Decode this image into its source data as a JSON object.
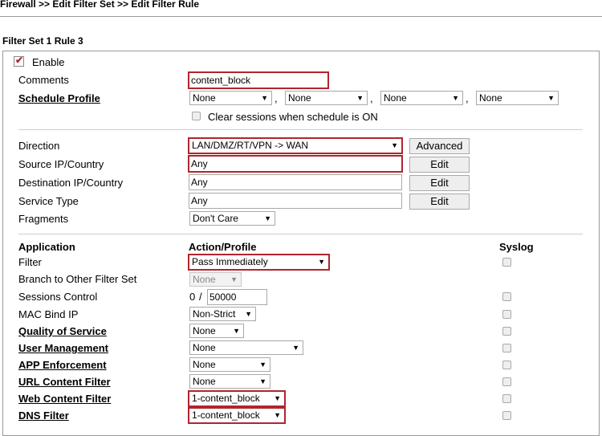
{
  "breadcrumb": "Firewall >> Edit Filter Set >> Edit Filter Rule",
  "set_title": "Filter Set 1 Rule 3",
  "enable": {
    "label": "Enable",
    "checked": true
  },
  "comments": {
    "label": "Comments",
    "value": "content_block"
  },
  "schedule": {
    "label": "Schedule Profile",
    "values": [
      "None",
      "None",
      "None",
      "None"
    ],
    "separator": ",",
    "clear_label": "Clear sessions when schedule is ON"
  },
  "direction": {
    "label": "Direction",
    "value": "LAN/DMZ/RT/VPN -> WAN",
    "button": "Advanced"
  },
  "source": {
    "label": "Source IP/Country",
    "value": "Any",
    "button": "Edit"
  },
  "destination": {
    "label": "Destination IP/Country",
    "value": "Any",
    "button": "Edit"
  },
  "service": {
    "label": "Service Type",
    "value": "Any",
    "button": "Edit"
  },
  "fragments": {
    "label": "Fragments",
    "value": "Don't Care"
  },
  "headers": {
    "application": "Application",
    "action": "Action/Profile",
    "syslog": "Syslog"
  },
  "filter": {
    "label": "Filter",
    "value": "Pass Immediately"
  },
  "branch": {
    "label": "Branch to Other Filter Set",
    "value": "None"
  },
  "sessions": {
    "label": "Sessions Control",
    "current": "0",
    "separator": "/",
    "max": "50000"
  },
  "mac": {
    "label": "MAC Bind IP",
    "value": "Non-Strict"
  },
  "qos": {
    "label": "Quality of Service",
    "value": "None"
  },
  "user_mgmt": {
    "label": "User Management",
    "value": "None"
  },
  "app_enf": {
    "label": "APP Enforcement",
    "value": "None"
  },
  "url_filter": {
    "label": "URL Content Filter",
    "value": "None"
  },
  "web_filter": {
    "label": "Web Content Filter",
    "value": "1-content_block"
  },
  "dns_filter": {
    "label": "DNS Filter",
    "value": "1-content_block"
  },
  "colors": {
    "highlight": "#b0252e",
    "border": "#a9a9a9"
  }
}
